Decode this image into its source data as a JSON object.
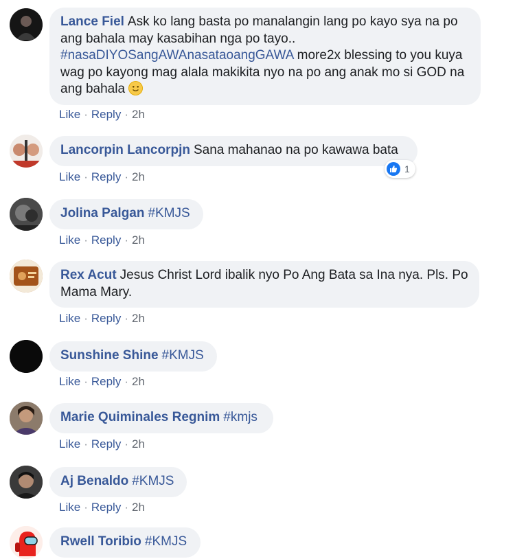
{
  "colors": {
    "author": "#385898",
    "bubble_bg": "#f0f2f5",
    "action_link": "#385898",
    "like_blue": "#1877f2"
  },
  "actions": {
    "like": "Like",
    "reply": "Reply",
    "separator": "·"
  },
  "comments": [
    {
      "author": "Lance Fiel",
      "text_1": "Ask ko lang basta po manalangin lang po kayo sya na po ang bahala may kasabihan nga po tayo..",
      "hashtag": "#nasaDIYOSangAWAnasataoangGAWA",
      "text_2": "more2x blessing to you kuya wag po kayong mag alala makikita nyo na po ang anak mo si GOD na ang bahala",
      "emoji": "slightly-smiling-face",
      "time": "2h"
    },
    {
      "author": "Lancorpin Lancorpjn",
      "text": "Sana mahanao na po kawawa bata",
      "reaction_icon": "like-icon",
      "reaction_count": "1",
      "time": "2h"
    },
    {
      "author": "Jolina Palgan",
      "text": "#KMJS",
      "time": "2h"
    },
    {
      "author": "Rex Acut",
      "text": "Jesus Christ Lord ibalik nyo Po Ang Bata sa Ina nya. Pls. Po Mama Mary.",
      "time": "2h"
    },
    {
      "author": "Sunshine Shine",
      "text": "#KMJS",
      "time": "2h"
    },
    {
      "author": "Marie Quiminales Regnim",
      "text": "#kmjs",
      "time": "2h"
    },
    {
      "author": "Aj Benaldo",
      "text": "#KMJS",
      "time": "2h"
    },
    {
      "author": "Rwell Toribio",
      "text": "#KMJS"
    }
  ]
}
